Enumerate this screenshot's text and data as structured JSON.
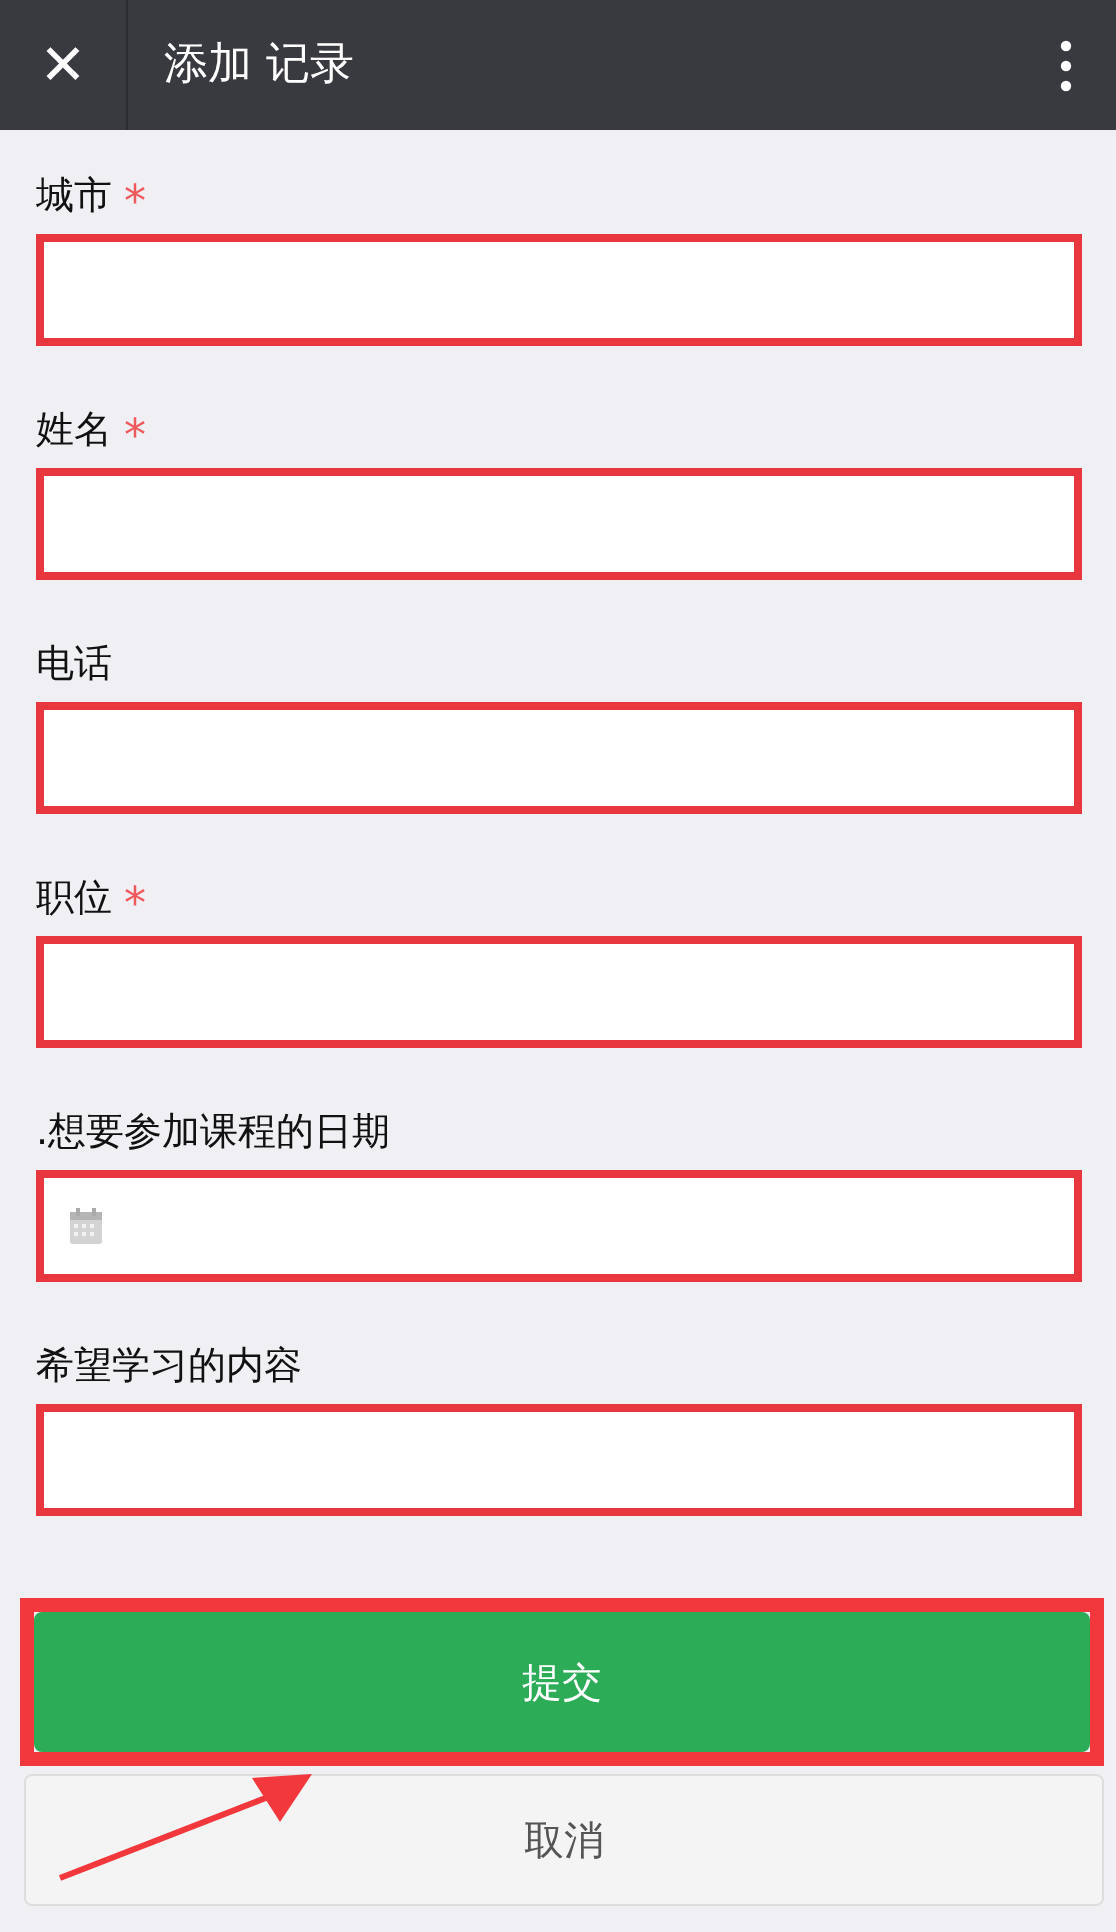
{
  "header": {
    "close_glyph": "✕",
    "title": "添加 记录"
  },
  "fields": [
    {
      "label": "城市",
      "required": true,
      "kind": "text",
      "highlighted": true
    },
    {
      "label": "姓名",
      "required": true,
      "kind": "text",
      "highlighted": true
    },
    {
      "label": "电话",
      "required": false,
      "kind": "text",
      "highlighted": true
    },
    {
      "label": "职位",
      "required": true,
      "kind": "text",
      "highlighted": true
    },
    {
      "label": ".想要参加课程的日期",
      "required": false,
      "kind": "date",
      "highlighted": true
    },
    {
      "label": "希望学习的内容",
      "required": false,
      "kind": "text",
      "highlighted": true
    }
  ],
  "required_mark": "*",
  "buttons": [
    {
      "label": "提交",
      "kind": "primary",
      "highlighted": true
    },
    {
      "label": "取消",
      "kind": "secondary",
      "highlighted": false
    }
  ]
}
